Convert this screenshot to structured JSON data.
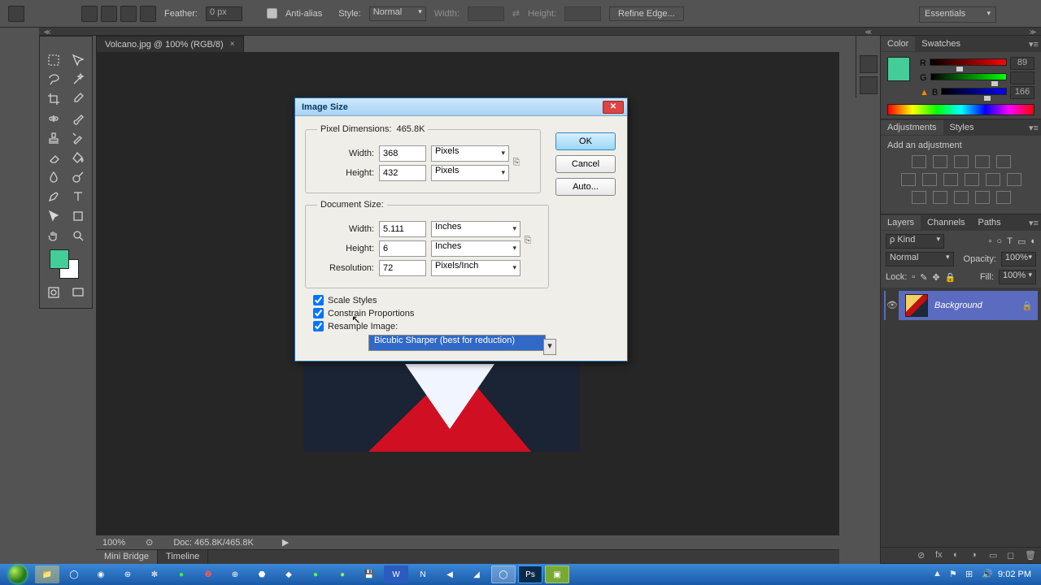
{
  "options_bar": {
    "feather_label": "Feather:",
    "feather_value": "0 px",
    "antialias_label": "Anti-alias",
    "style_label": "Style:",
    "style_value": "Normal",
    "width_label": "Width:",
    "height_label": "Height:",
    "refine_label": "Refine Edge..."
  },
  "workspace": {
    "value": "Essentials"
  },
  "tab": {
    "title": "Volcano.jpg @ 100% (RGB/8)"
  },
  "status": {
    "zoom": "100%",
    "doc": "Doc: 465.8K/465.8K"
  },
  "bottom_tabs": {
    "mini_bridge": "Mini Bridge",
    "timeline": "Timeline"
  },
  "color_panel": {
    "tab_color": "Color",
    "tab_swatches": "Swatches",
    "r_label": "R",
    "r_val": "89",
    "g_label": "G",
    "g_val": "",
    "b_label": "B",
    "b_val": "166",
    "accent": "#44cc99"
  },
  "adjust_panel": {
    "tab_adjust": "Adjustments",
    "tab_styles": "Styles",
    "add_label": "Add an adjustment"
  },
  "layers_panel": {
    "tab_layers": "Layers",
    "tab_channels": "Channels",
    "tab_paths": "Paths",
    "kind_label": "ρ Kind",
    "blend_value": "Normal",
    "opacity_label": "Opacity:",
    "opacity_value": "100%",
    "lock_label": "Lock:",
    "fill_label": "Fill:",
    "fill_value": "100%",
    "layer_name": "Background"
  },
  "dialog": {
    "title": "Image Size",
    "pix_legend": "Pixel Dimensions:",
    "pix_size": "465.8K",
    "width_label": "Width:",
    "pw": "368",
    "pw_unit": "Pixels",
    "height_label": "Height:",
    "ph": "432",
    "ph_unit": "Pixels",
    "doc_legend": "Document Size:",
    "dw": "5.111",
    "dw_unit": "Inches",
    "dh": "6",
    "dh_unit": "Inches",
    "res_label": "Resolution:",
    "res": "72",
    "res_unit": "Pixels/Inch",
    "scale_styles": "Scale Styles",
    "constrain": "Constrain Proportions",
    "resample": "Resample Image:",
    "method": "Bicubic Sharper (best for reduction)",
    "ok": "OK",
    "cancel": "Cancel",
    "auto": "Auto..."
  },
  "systray": {
    "time": "9:02 PM"
  }
}
